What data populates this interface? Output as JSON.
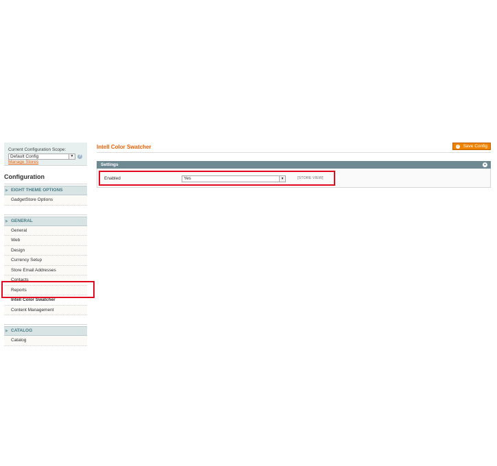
{
  "scope": {
    "label": "Current Configuration Scope:",
    "selected": "Default Config",
    "manage_link": "Manage Stores"
  },
  "sidebar": {
    "title": "Configuration",
    "sections": [
      {
        "label": "EIGHT THEME OPTIONS",
        "items": [
          "GadgetStore Options"
        ]
      },
      {
        "label": "GENERAL",
        "items": [
          "General",
          "Web",
          "Design",
          "Currency Setup",
          "Store Email Addresses",
          "Contacts",
          "Reports",
          "Intell Color Swatcher",
          "Content Management"
        ]
      },
      {
        "label": "CATALOG",
        "items": [
          "Catalog"
        ]
      }
    ],
    "active_item": "Intell Color Swatcher"
  },
  "main": {
    "page_title": "Intell Color Swatcher",
    "save_button": "Save Config",
    "fieldset_title": "Settings",
    "field": {
      "label": "Enabled",
      "value": "Yes",
      "scope_hint": "[STORE VIEW]"
    }
  },
  "colors": {
    "accent": "#eb5e00",
    "button": "#f18200",
    "fieldset_header": "#6f8992",
    "highlight": "#e1081d"
  }
}
